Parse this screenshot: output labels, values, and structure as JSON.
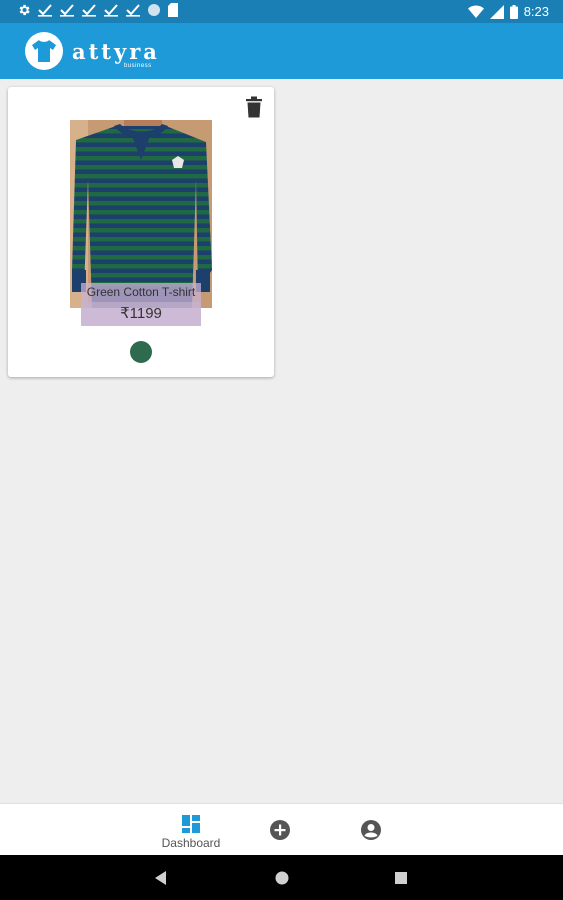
{
  "status_bar": {
    "time": "8:23",
    "left_icons": [
      "gear-icon",
      "check-icon",
      "check-icon",
      "check-icon",
      "check-icon",
      "check-icon",
      "circle-icon",
      "sd-card-icon"
    ],
    "right_icons": [
      "wifi-icon",
      "signal-icon",
      "battery-icon"
    ]
  },
  "app_bar": {
    "brand": "attyra",
    "brand_sub": "business",
    "color": "#1f9ad9"
  },
  "products": [
    {
      "name": "Green Cotton T-shirt",
      "price": "₹1199",
      "color_swatch": "#2e6b4e"
    }
  ],
  "bottom_nav": {
    "dashboard_label": "Dashboard",
    "active_color": "#1f9ad9",
    "icons": [
      "dashboard-icon",
      "add-circle-icon",
      "account-circle-icon"
    ]
  },
  "system_nav": {
    "icons": [
      "back-icon",
      "home-icon",
      "recent-apps-icon"
    ]
  }
}
